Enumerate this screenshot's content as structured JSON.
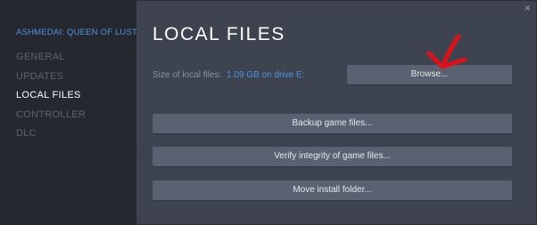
{
  "window": {
    "close_icon": "×"
  },
  "sidebar": {
    "game_title": "ASHMEDAI: QUEEN OF LUST",
    "items": [
      {
        "label": "GENERAL",
        "active": false
      },
      {
        "label": "UPDATES",
        "active": false
      },
      {
        "label": "LOCAL FILES",
        "active": true
      },
      {
        "label": "CONTROLLER",
        "active": false
      },
      {
        "label": "DLC",
        "active": false
      }
    ]
  },
  "main": {
    "heading": "LOCAL FILES",
    "size_label": "Size of local files:",
    "size_value": "1.09 GB on drive E:",
    "browse_label": "Browse...",
    "backup_label": "Backup game files...",
    "verify_label": "Verify integrity of game files...",
    "move_label": "Move install folder..."
  },
  "colors": {
    "accent": "#4e93e6",
    "annotation_arrow": "#e0101a"
  }
}
